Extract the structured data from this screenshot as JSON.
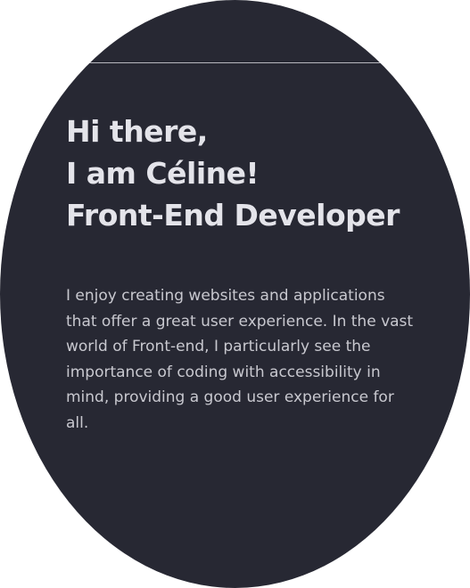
{
  "hero": {
    "greeting_lines": [
      "Hi there,",
      "I am Céline!",
      "Front-End Developer"
    ],
    "intro": "I enjoy creating websites and applications that offer a great user experience. In the vast world of Front-end, I particularly see the importance of coding with accessibility in mind, providing a good user experience for all."
  },
  "colors": {
    "background": "#272833",
    "heading": "#e4e4ea",
    "text": "#c8c8cf"
  }
}
